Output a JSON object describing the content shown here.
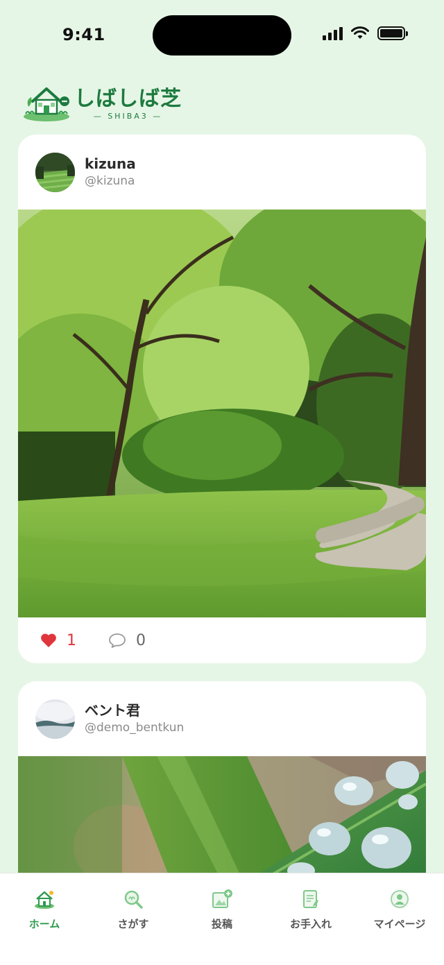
{
  "status_bar": {
    "time": "9:41"
  },
  "logo": {
    "title": "しばしば芝",
    "subtitle": "SHIBA3"
  },
  "posts": [
    {
      "user_name": "kizuna",
      "user_handle": "@kizuna",
      "likes": "1",
      "comments": "0",
      "image": "park-lawn-trees-path"
    },
    {
      "user_name": "ベント君",
      "user_handle": "@demo_bentkun",
      "image": "grass-blade-water-droplets"
    }
  ],
  "tabs": [
    {
      "label": "ホーム",
      "icon": "home-icon",
      "active": true
    },
    {
      "label": "さがす",
      "icon": "search-icon",
      "active": false
    },
    {
      "label": "投稿",
      "icon": "post-add-icon",
      "active": false
    },
    {
      "label": "お手入れ",
      "icon": "care-icon",
      "active": false
    },
    {
      "label": "マイページ",
      "icon": "mypage-icon",
      "active": false
    }
  ],
  "colors": {
    "background": "#e6f6e6",
    "accent": "#2e9a4e",
    "like": "#e0353d",
    "brand": "#1d7a3f"
  }
}
